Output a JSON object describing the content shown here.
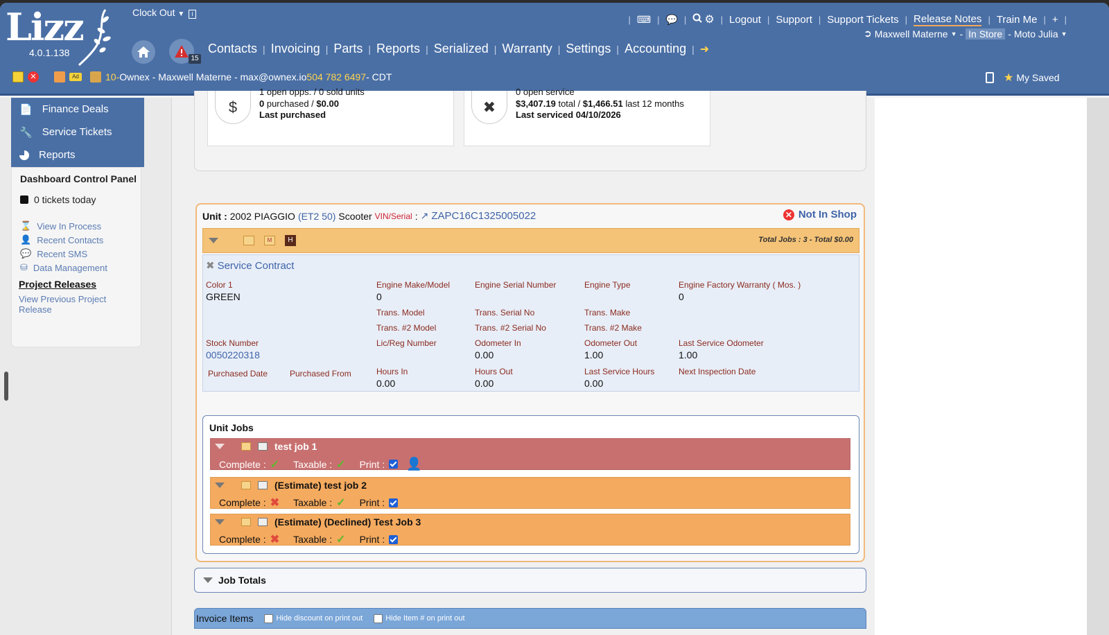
{
  "app": {
    "name": "Lizz",
    "version": "4.0.1.138"
  },
  "header": {
    "clock_out": "Clock Out",
    "alert_count": "15",
    "main_nav": [
      "Contacts",
      "Invoicing",
      "Parts",
      "Reports",
      "Serialized",
      "Warranty",
      "Settings",
      "Accounting"
    ],
    "top_nav": {
      "logout": "Logout",
      "support": "Support",
      "support_tickets": "Support Tickets",
      "release_notes": "Release Notes",
      "train_me": "Train Me",
      "plus": "+"
    },
    "user": "Maxwell Materne",
    "location": "In Store",
    "store": "Moto Julia",
    "context_prefix": "10-",
    "context_text": " Ownex - Maxwell Materne - max@ownex.io ",
    "context_phone": "504 782 6497",
    "context_tz": " - CDT",
    "my_saved": "My Saved"
  },
  "sidebar": {
    "items": [
      {
        "label": "Finance Deals",
        "icon": "finance-icon"
      },
      {
        "label": "Service Tickets",
        "icon": "wrench-icon"
      },
      {
        "label": "Reports",
        "icon": "pie-chart-icon"
      }
    ],
    "dashboard_title": "Dashboard Control Panel",
    "tickets_today": "0 tickets today",
    "links": [
      "View In Process",
      "Recent Contacts",
      "Recent SMS",
      "Data Management"
    ],
    "project_releases": "Project Releases",
    "view_previous": "View Previous Project Release"
  },
  "summary": {
    "sales": {
      "line1": "1 open opps. / 0 sold units",
      "line2_bold": "0",
      "line2": " purchased / ",
      "line2_amount": "$0.00",
      "line3": "Last purchased"
    },
    "service": {
      "line1": "0 open service",
      "line2_total": "$3,407.19",
      "line2_mid": " total / ",
      "line2_amount": "$1,466.51",
      "line2_end": " last 12 months",
      "line3": "Last serviced 04/10/2026"
    }
  },
  "unit": {
    "label": "Unit :",
    "year_make": "2002 PIAGGIO",
    "model": "(ET2 50)",
    "type": "Scooter",
    "vin_label": "VIN/Serial",
    "vin": "ZAPC16C1325005022",
    "status": "Not In Shop",
    "totals": "Total Jobs : 3 - Total $0.00",
    "service_contract": "Service Contract",
    "fields": {
      "color_label": "Color 1",
      "color": "GREEN",
      "engine_make_label": "Engine Make/Model",
      "engine_make": "0",
      "engine_serial_label": "Engine Serial Number",
      "engine_type_label": "Engine Type",
      "engine_warranty_label": "Engine Factory Warranty ( Mos. )",
      "engine_warranty": "0",
      "trans_model_label": "Trans. Model",
      "trans_serial_label": "Trans. Serial No",
      "trans_make_label": "Trans. Make",
      "trans2_model_label": "Trans. #2 Model",
      "trans2_serial_label": "Trans. #2 Serial No",
      "trans2_make_label": "Trans. #2 Make",
      "stock_label": "Stock Number",
      "stock": "0050220318",
      "lic_label": "Lic/Reg Number",
      "odo_in_label": "Odometer In",
      "odo_in": "0.00",
      "odo_out_label": "Odometer Out",
      "odo_out": "1.00",
      "last_odo_label": "Last Service Odometer",
      "last_odo": "1.00",
      "purchased_date_label": "Purchased Date",
      "purchased_from_label": "Purchased From",
      "hours_in_label": "Hours In",
      "hours_in": "0.00",
      "hours_out_label": "Hours Out",
      "hours_out": "0.00",
      "last_hours_label": "Last Service Hours",
      "last_hours": "0.00",
      "next_insp_label": "Next Inspection Date"
    }
  },
  "jobs": {
    "title": "Unit Jobs",
    "complete_label": "Complete :",
    "taxable_label": "Taxable :",
    "print_label": "Print :",
    "items": [
      {
        "name": "test job 1",
        "complete": true,
        "taxable": true,
        "print": true
      },
      {
        "name": "(Estimate) test job 2",
        "complete": false,
        "taxable": true,
        "print": true
      },
      {
        "name": "(Estimate) (Declined) Test Job 3",
        "complete": false,
        "taxable": true,
        "print": true
      }
    ]
  },
  "job_totals": "Job Totals",
  "invoice": {
    "title": "Invoice Items",
    "hide_discount": "Hide discount on print out",
    "hide_item": "Hide Item # on print out"
  },
  "colors": {
    "header": "#4a6fa5",
    "job_red": "#c87070",
    "job_orange": "#f4aa5f",
    "link": "#3f64a8"
  }
}
